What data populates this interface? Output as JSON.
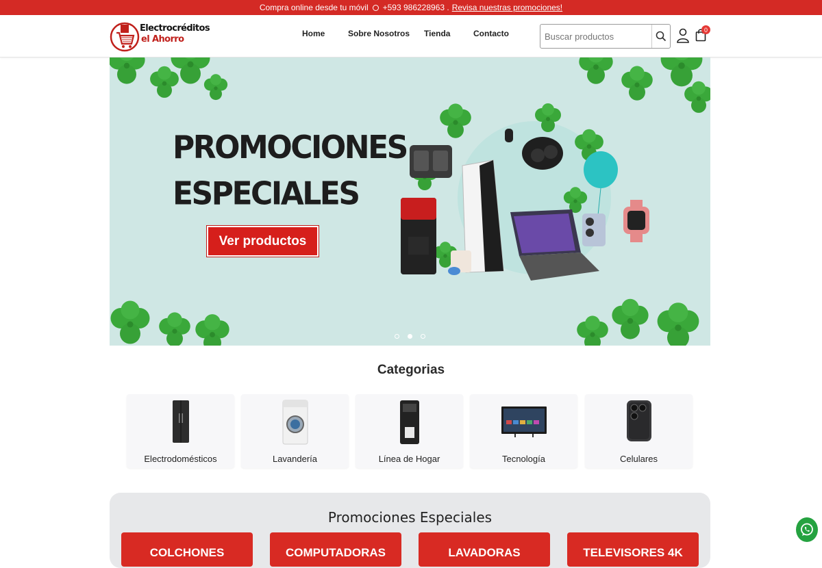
{
  "topbar": {
    "text": "Compra online desde tu móvil",
    "phone": "+593 986228963 .",
    "promo_link": "Revisa nuestras promociones!"
  },
  "header": {
    "logo_line1": "Electrocréditos",
    "logo_line2": "el Ahorro",
    "nav": [
      "Home",
      "Sobre Nosotros",
      "Tienda",
      "Contacto"
    ],
    "search_placeholder": "Buscar productos",
    "cart_count": "0"
  },
  "hero": {
    "title_line1": "PROMOCIONES",
    "title_line2": "ESPECIALES",
    "button_label": "Ver productos",
    "slides": 3,
    "active_slide": 2
  },
  "categories": {
    "title": "Categorias",
    "items": [
      "Electrodomésticos",
      "Lavandería",
      "Línea de Hogar",
      "Tecnología",
      "Celulares"
    ]
  },
  "promotions": {
    "title": "Promociones Especiales",
    "cards": [
      "COLCHONES",
      "COMPUTADORAS",
      "LAVADORAS",
      "TELEVISORES 4K"
    ]
  },
  "colors": {
    "brand_red": "#d42a25",
    "hero_bg": "#cfe7e4",
    "clover_green": "#3aa83a",
    "whatsapp_green": "#25a240"
  },
  "icons": {
    "search": "search-icon",
    "user": "user-icon",
    "cart": "shopping-bag-icon",
    "whatsapp": "whatsapp-icon"
  }
}
